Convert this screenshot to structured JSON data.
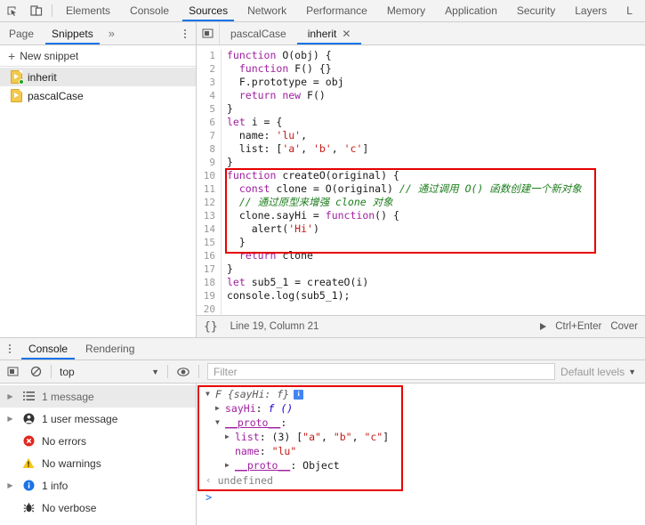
{
  "toolbar": {
    "inspect_icon": "inspect-cursor-icon",
    "device_icon": "device-toolbar-icon",
    "tabs": [
      {
        "label": "Elements",
        "active": false
      },
      {
        "label": "Console",
        "active": false
      },
      {
        "label": "Sources",
        "active": true
      },
      {
        "label": "Network",
        "active": false
      },
      {
        "label": "Performance",
        "active": false
      },
      {
        "label": "Memory",
        "active": false
      },
      {
        "label": "Application",
        "active": false
      },
      {
        "label": "Security",
        "active": false
      },
      {
        "label": "Layers",
        "active": false
      },
      {
        "label": "L",
        "active": false
      }
    ]
  },
  "navigator": {
    "tabs": [
      {
        "label": "Page",
        "active": false
      },
      {
        "label": "Snippets",
        "active": true
      }
    ],
    "more_label": "»",
    "new_snippet_label": "New snippet",
    "plus": "+",
    "snippets": [
      {
        "name": "inherit",
        "selected": true,
        "running": true
      },
      {
        "name": "pascalCase",
        "selected": false,
        "running": false
      }
    ]
  },
  "editor": {
    "tabs": [
      {
        "label": "pascalCase",
        "active": false,
        "closable": false
      },
      {
        "label": "inherit",
        "active": true,
        "closable": true
      }
    ],
    "close_glyph": "✕",
    "lines": [
      {
        "n": "1",
        "tokens": [
          {
            "t": "function ",
            "c": "kw"
          },
          {
            "t": "O(obj) {",
            "c": ""
          }
        ]
      },
      {
        "n": "2",
        "tokens": [
          {
            "t": "  ",
            "c": ""
          },
          {
            "t": "function ",
            "c": "kw"
          },
          {
            "t": "F() {}",
            "c": ""
          }
        ]
      },
      {
        "n": "3",
        "tokens": [
          {
            "t": "  F.prototype = obj",
            "c": ""
          }
        ]
      },
      {
        "n": "4",
        "tokens": [
          {
            "t": "  ",
            "c": ""
          },
          {
            "t": "return new ",
            "c": "kw"
          },
          {
            "t": "F()",
            "c": ""
          }
        ]
      },
      {
        "n": "5",
        "tokens": [
          {
            "t": "}",
            "c": ""
          }
        ]
      },
      {
        "n": "6",
        "tokens": [
          {
            "t": "let ",
            "c": "kw"
          },
          {
            "t": "i = {",
            "c": ""
          }
        ]
      },
      {
        "n": "7",
        "tokens": [
          {
            "t": "  name: ",
            "c": ""
          },
          {
            "t": "'lu'",
            "c": "str"
          },
          {
            "t": ",",
            "c": ""
          }
        ]
      },
      {
        "n": "8",
        "tokens": [
          {
            "t": "  list: [",
            "c": ""
          },
          {
            "t": "'a'",
            "c": "str"
          },
          {
            "t": ", ",
            "c": ""
          },
          {
            "t": "'b'",
            "c": "str"
          },
          {
            "t": ", ",
            "c": ""
          },
          {
            "t": "'c'",
            "c": "str"
          },
          {
            "t": "]",
            "c": ""
          }
        ]
      },
      {
        "n": "9",
        "tokens": [
          {
            "t": "}",
            "c": ""
          }
        ]
      },
      {
        "n": "10",
        "tokens": [
          {
            "t": "function ",
            "c": "kw"
          },
          {
            "t": "createO(original) {",
            "c": ""
          }
        ]
      },
      {
        "n": "11",
        "tokens": [
          {
            "t": "  ",
            "c": ""
          },
          {
            "t": "const ",
            "c": "kw"
          },
          {
            "t": "clone = O(original) ",
            "c": ""
          },
          {
            "t": "// 通过调用 O() 函数创建一个新对象",
            "c": "cmt"
          }
        ]
      },
      {
        "n": "12",
        "tokens": [
          {
            "t": "  ",
            "c": ""
          },
          {
            "t": "// 通过原型来增强 clone 对象",
            "c": "cmt"
          }
        ]
      },
      {
        "n": "13",
        "tokens": [
          {
            "t": "  clone.sayHi = ",
            "c": ""
          },
          {
            "t": "function",
            "c": "kw"
          },
          {
            "t": "() {",
            "c": ""
          }
        ]
      },
      {
        "n": "14",
        "tokens": [
          {
            "t": "    alert(",
            "c": ""
          },
          {
            "t": "'Hi'",
            "c": "str"
          },
          {
            "t": ")",
            "c": ""
          }
        ]
      },
      {
        "n": "15",
        "tokens": [
          {
            "t": "  }",
            "c": ""
          }
        ]
      },
      {
        "n": "16",
        "tokens": [
          {
            "t": "  ",
            "c": ""
          },
          {
            "t": "return ",
            "c": "kw"
          },
          {
            "t": "clone",
            "c": ""
          }
        ]
      },
      {
        "n": "17",
        "tokens": [
          {
            "t": "}",
            "c": ""
          }
        ]
      },
      {
        "n": "18",
        "tokens": [
          {
            "t": "let ",
            "c": "kw"
          },
          {
            "t": "sub5_1 = createO(i)",
            "c": ""
          }
        ]
      },
      {
        "n": "19",
        "tokens": [
          {
            "t": "console.log(sub5_1);",
            "c": ""
          }
        ]
      },
      {
        "n": "20",
        "tokens": [
          {
            "t": "",
            "c": ""
          }
        ]
      }
    ],
    "status": {
      "format_icon": "{}",
      "cursor_position": "Line 19, Column 21",
      "run_shortcut": "Ctrl+Enter",
      "coverage_label": "Cover"
    }
  },
  "drawer": {
    "tabs": [
      {
        "label": "Console",
        "active": true
      },
      {
        "label": "Rendering",
        "active": false
      }
    ],
    "console_toolbar": {
      "sidebar_toggle_icon": "sidebar-toggle-icon",
      "clear_icon": "clear-console-icon",
      "context": "top",
      "eye_icon": "live-expression-icon",
      "filter_placeholder": "Filter",
      "levels_label": "Default levels",
      "caret": "▼"
    },
    "sidebar": [
      {
        "label": "1 message",
        "icon": "list-icon",
        "expandable": true,
        "selected": true
      },
      {
        "label": "1 user message",
        "icon": "user-icon",
        "expandable": true,
        "selected": false
      },
      {
        "label": "No errors",
        "icon": "error-icon",
        "expandable": false,
        "selected": false
      },
      {
        "label": "No warnings",
        "icon": "warning-icon",
        "expandable": false,
        "selected": false
      },
      {
        "label": "1 info",
        "icon": "info-icon",
        "expandable": true,
        "selected": false
      },
      {
        "label": "No verbose",
        "icon": "verbose-bug-icon",
        "expandable": false,
        "selected": false
      }
    ],
    "output": {
      "object_header": "F {sayHi: f}",
      "info_badge": "i",
      "rows": [
        {
          "tw": "▶",
          "indent": 1,
          "parts": [
            {
              "t": "sayHi",
              "c": "prop-name"
            },
            {
              "t": ": ",
              "c": "g-val"
            },
            {
              "t": "f ()",
              "c": "fn-italic"
            }
          ]
        },
        {
          "tw": "▼",
          "indent": 1,
          "parts": [
            {
              "t": "__proto__",
              "c": "prop-name u"
            },
            {
              "t": ":",
              "c": "g-val"
            }
          ]
        },
        {
          "tw": "▶",
          "indent": 2,
          "parts": [
            {
              "t": "list",
              "c": "prop-name"
            },
            {
              "t": ": (3) [",
              "c": "g-val"
            },
            {
              "t": "\"a\"",
              "c": "s-val"
            },
            {
              "t": ", ",
              "c": "g-val"
            },
            {
              "t": "\"b\"",
              "c": "s-val"
            },
            {
              "t": ", ",
              "c": "g-val"
            },
            {
              "t": "\"c\"",
              "c": "s-val"
            },
            {
              "t": "]",
              "c": "g-val"
            }
          ]
        },
        {
          "tw": "",
          "indent": 2,
          "parts": [
            {
              "t": "name",
              "c": "prop-name"
            },
            {
              "t": ": ",
              "c": "g-val"
            },
            {
              "t": "\"lu\"",
              "c": "s-val"
            }
          ]
        },
        {
          "tw": "▶",
          "indent": 2,
          "parts": [
            {
              "t": "__proto__",
              "c": "prop-name u"
            },
            {
              "t": ": Object",
              "c": "g-val"
            }
          ]
        }
      ],
      "return_arrow": "‹",
      "return_value": "undefined",
      "prompt": ">"
    }
  },
  "colors": {
    "accent": "#1a73e8",
    "annotation": "#e60000",
    "keyword": "#a020a0",
    "string": "#c41a16",
    "comment": "#1d7d1d",
    "toolbar_bg": "#f3f3f3"
  }
}
